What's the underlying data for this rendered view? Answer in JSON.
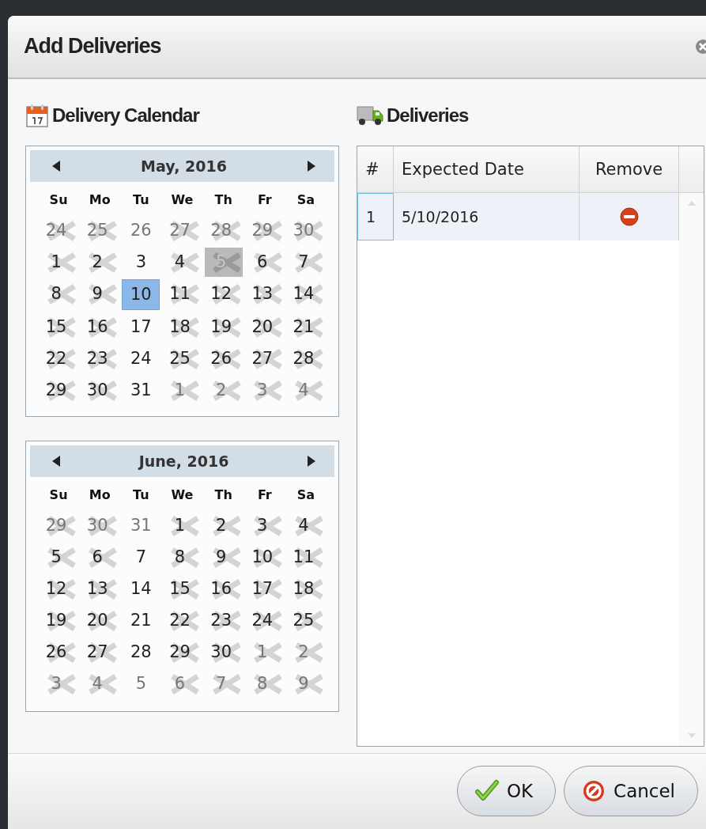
{
  "window": {
    "title": "Add Deliveries"
  },
  "calendar_section": {
    "title": "Delivery Calendar",
    "months": [
      {
        "title": "May, 2016",
        "weekdays": [
          "Su",
          "Mo",
          "Tu",
          "We",
          "Th",
          "Fr",
          "Sa"
        ],
        "weeks": [
          [
            {
              "day": "24",
              "other_month": true,
              "disabled": true,
              "selected": false,
              "today": false
            },
            {
              "day": "25",
              "other_month": true,
              "disabled": true,
              "selected": false,
              "today": false
            },
            {
              "day": "26",
              "other_month": true,
              "disabled": false,
              "selected": false,
              "today": false
            },
            {
              "day": "27",
              "other_month": true,
              "disabled": true,
              "selected": false,
              "today": false
            },
            {
              "day": "28",
              "other_month": true,
              "disabled": true,
              "selected": false,
              "today": false
            },
            {
              "day": "29",
              "other_month": true,
              "disabled": true,
              "selected": false,
              "today": false
            },
            {
              "day": "30",
              "other_month": true,
              "disabled": true,
              "selected": false,
              "today": false
            }
          ],
          [
            {
              "day": "1",
              "other_month": false,
              "disabled": true,
              "selected": false,
              "today": false
            },
            {
              "day": "2",
              "other_month": false,
              "disabled": true,
              "selected": false,
              "today": false
            },
            {
              "day": "3",
              "other_month": false,
              "disabled": false,
              "selected": false,
              "today": false
            },
            {
              "day": "4",
              "other_month": false,
              "disabled": true,
              "selected": false,
              "today": false
            },
            {
              "day": "5",
              "other_month": false,
              "disabled": true,
              "selected": false,
              "today": true
            },
            {
              "day": "6",
              "other_month": false,
              "disabled": true,
              "selected": false,
              "today": false
            },
            {
              "day": "7",
              "other_month": false,
              "disabled": true,
              "selected": false,
              "today": false
            }
          ],
          [
            {
              "day": "8",
              "other_month": false,
              "disabled": true,
              "selected": false,
              "today": false
            },
            {
              "day": "9",
              "other_month": false,
              "disabled": true,
              "selected": false,
              "today": false
            },
            {
              "day": "10",
              "other_month": false,
              "disabled": false,
              "selected": true,
              "today": false
            },
            {
              "day": "11",
              "other_month": false,
              "disabled": true,
              "selected": false,
              "today": false
            },
            {
              "day": "12",
              "other_month": false,
              "disabled": true,
              "selected": false,
              "today": false
            },
            {
              "day": "13",
              "other_month": false,
              "disabled": true,
              "selected": false,
              "today": false
            },
            {
              "day": "14",
              "other_month": false,
              "disabled": true,
              "selected": false,
              "today": false
            }
          ],
          [
            {
              "day": "15",
              "other_month": false,
              "disabled": true,
              "selected": false,
              "today": false
            },
            {
              "day": "16",
              "other_month": false,
              "disabled": true,
              "selected": false,
              "today": false
            },
            {
              "day": "17",
              "other_month": false,
              "disabled": false,
              "selected": false,
              "today": false
            },
            {
              "day": "18",
              "other_month": false,
              "disabled": true,
              "selected": false,
              "today": false
            },
            {
              "day": "19",
              "other_month": false,
              "disabled": true,
              "selected": false,
              "today": false
            },
            {
              "day": "20",
              "other_month": false,
              "disabled": true,
              "selected": false,
              "today": false
            },
            {
              "day": "21",
              "other_month": false,
              "disabled": true,
              "selected": false,
              "today": false
            }
          ],
          [
            {
              "day": "22",
              "other_month": false,
              "disabled": true,
              "selected": false,
              "today": false
            },
            {
              "day": "23",
              "other_month": false,
              "disabled": true,
              "selected": false,
              "today": false
            },
            {
              "day": "24",
              "other_month": false,
              "disabled": false,
              "selected": false,
              "today": false
            },
            {
              "day": "25",
              "other_month": false,
              "disabled": true,
              "selected": false,
              "today": false
            },
            {
              "day": "26",
              "other_month": false,
              "disabled": true,
              "selected": false,
              "today": false
            },
            {
              "day": "27",
              "other_month": false,
              "disabled": true,
              "selected": false,
              "today": false
            },
            {
              "day": "28",
              "other_month": false,
              "disabled": true,
              "selected": false,
              "today": false
            }
          ],
          [
            {
              "day": "29",
              "other_month": false,
              "disabled": true,
              "selected": false,
              "today": false
            },
            {
              "day": "30",
              "other_month": false,
              "disabled": true,
              "selected": false,
              "today": false
            },
            {
              "day": "31",
              "other_month": false,
              "disabled": false,
              "selected": false,
              "today": false
            },
            {
              "day": "1",
              "other_month": true,
              "disabled": true,
              "selected": false,
              "today": false
            },
            {
              "day": "2",
              "other_month": true,
              "disabled": true,
              "selected": false,
              "today": false
            },
            {
              "day": "3",
              "other_month": true,
              "disabled": true,
              "selected": false,
              "today": false
            },
            {
              "day": "4",
              "other_month": true,
              "disabled": true,
              "selected": false,
              "today": false
            }
          ]
        ]
      },
      {
        "title": "June, 2016",
        "weekdays": [
          "Su",
          "Mo",
          "Tu",
          "We",
          "Th",
          "Fr",
          "Sa"
        ],
        "weeks": [
          [
            {
              "day": "29",
              "other_month": true,
              "disabled": true,
              "selected": false,
              "today": false
            },
            {
              "day": "30",
              "other_month": true,
              "disabled": true,
              "selected": false,
              "today": false
            },
            {
              "day": "31",
              "other_month": true,
              "disabled": false,
              "selected": false,
              "today": false
            },
            {
              "day": "1",
              "other_month": false,
              "disabled": true,
              "selected": false,
              "today": false
            },
            {
              "day": "2",
              "other_month": false,
              "disabled": true,
              "selected": false,
              "today": false
            },
            {
              "day": "3",
              "other_month": false,
              "disabled": true,
              "selected": false,
              "today": false
            },
            {
              "day": "4",
              "other_month": false,
              "disabled": true,
              "selected": false,
              "today": false
            }
          ],
          [
            {
              "day": "5",
              "other_month": false,
              "disabled": true,
              "selected": false,
              "today": false
            },
            {
              "day": "6",
              "other_month": false,
              "disabled": true,
              "selected": false,
              "today": false
            },
            {
              "day": "7",
              "other_month": false,
              "disabled": false,
              "selected": false,
              "today": false
            },
            {
              "day": "8",
              "other_month": false,
              "disabled": true,
              "selected": false,
              "today": false
            },
            {
              "day": "9",
              "other_month": false,
              "disabled": true,
              "selected": false,
              "today": false
            },
            {
              "day": "10",
              "other_month": false,
              "disabled": true,
              "selected": false,
              "today": false
            },
            {
              "day": "11",
              "other_month": false,
              "disabled": true,
              "selected": false,
              "today": false
            }
          ],
          [
            {
              "day": "12",
              "other_month": false,
              "disabled": true,
              "selected": false,
              "today": false
            },
            {
              "day": "13",
              "other_month": false,
              "disabled": true,
              "selected": false,
              "today": false
            },
            {
              "day": "14",
              "other_month": false,
              "disabled": false,
              "selected": false,
              "today": false
            },
            {
              "day": "15",
              "other_month": false,
              "disabled": true,
              "selected": false,
              "today": false
            },
            {
              "day": "16",
              "other_month": false,
              "disabled": true,
              "selected": false,
              "today": false
            },
            {
              "day": "17",
              "other_month": false,
              "disabled": true,
              "selected": false,
              "today": false
            },
            {
              "day": "18",
              "other_month": false,
              "disabled": true,
              "selected": false,
              "today": false
            }
          ],
          [
            {
              "day": "19",
              "other_month": false,
              "disabled": true,
              "selected": false,
              "today": false
            },
            {
              "day": "20",
              "other_month": false,
              "disabled": true,
              "selected": false,
              "today": false
            },
            {
              "day": "21",
              "other_month": false,
              "disabled": false,
              "selected": false,
              "today": false
            },
            {
              "day": "22",
              "other_month": false,
              "disabled": true,
              "selected": false,
              "today": false
            },
            {
              "day": "23",
              "other_month": false,
              "disabled": true,
              "selected": false,
              "today": false
            },
            {
              "day": "24",
              "other_month": false,
              "disabled": true,
              "selected": false,
              "today": false
            },
            {
              "day": "25",
              "other_month": false,
              "disabled": true,
              "selected": false,
              "today": false
            }
          ],
          [
            {
              "day": "26",
              "other_month": false,
              "disabled": true,
              "selected": false,
              "today": false
            },
            {
              "day": "27",
              "other_month": false,
              "disabled": true,
              "selected": false,
              "today": false
            },
            {
              "day": "28",
              "other_month": false,
              "disabled": false,
              "selected": false,
              "today": false
            },
            {
              "day": "29",
              "other_month": false,
              "disabled": true,
              "selected": false,
              "today": false
            },
            {
              "day": "30",
              "other_month": false,
              "disabled": true,
              "selected": false,
              "today": false
            },
            {
              "day": "1",
              "other_month": true,
              "disabled": true,
              "selected": false,
              "today": false
            },
            {
              "day": "2",
              "other_month": true,
              "disabled": true,
              "selected": false,
              "today": false
            }
          ],
          [
            {
              "day": "3",
              "other_month": true,
              "disabled": true,
              "selected": false,
              "today": false
            },
            {
              "day": "4",
              "other_month": true,
              "disabled": true,
              "selected": false,
              "today": false
            },
            {
              "day": "5",
              "other_month": true,
              "disabled": false,
              "selected": false,
              "today": false
            },
            {
              "day": "6",
              "other_month": true,
              "disabled": true,
              "selected": false,
              "today": false
            },
            {
              "day": "7",
              "other_month": true,
              "disabled": true,
              "selected": false,
              "today": false
            },
            {
              "day": "8",
              "other_month": true,
              "disabled": true,
              "selected": false,
              "today": false
            },
            {
              "day": "9",
              "other_month": true,
              "disabled": true,
              "selected": false,
              "today": false
            }
          ]
        ]
      }
    ]
  },
  "deliveries_section": {
    "title": "Deliveries",
    "table": {
      "columns": [
        "#",
        "Expected Date",
        "Remove"
      ],
      "rows": [
        {
          "number": "1",
          "expected_date": "5/10/2016",
          "selected": true
        }
      ]
    }
  },
  "buttons": [
    {
      "kind": "ok",
      "label": "OK"
    },
    {
      "kind": "cancel",
      "label": "Cancel"
    }
  ]
}
